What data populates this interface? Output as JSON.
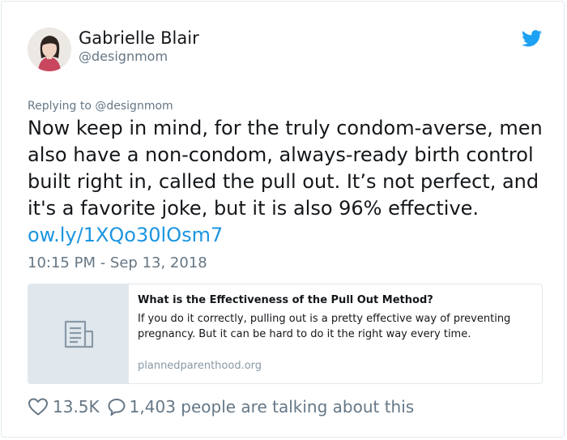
{
  "author": {
    "display_name": "Gabrielle Blair",
    "handle": "@designmom"
  },
  "tweet": {
    "reply_context": "Replying to @designmom",
    "text_lines": [
      "Now keep in mind, for the truly condom-averse, men",
      "also have a non-condom, always-ready birth control",
      "built right in, called the pull out. It’s not perfect, and",
      "it's a favorite joke, but it is also 96% effective."
    ],
    "link_text": "ow.ly/1XQo30lOsm7",
    "timestamp": "10:15 PM - Sep 13, 2018"
  },
  "link_card": {
    "title": "What is the Effectiveness of the Pull Out Method?",
    "description": "If you do it correctly, pulling out is a pretty effective way of preventing pregnancy. But it can be hard to do it the right way every time.",
    "domain": "plannedparenthood.org",
    "thumbnail_icon": "document-icon"
  },
  "engagement": {
    "likes": "13.5K",
    "replies_text": "1,403 people are talking about this"
  },
  "icons": {
    "brand": "twitter-bird-icon",
    "like": "heart-icon",
    "reply": "speech-bubble-icon"
  },
  "colors": {
    "link": "#1b95e0",
    "twitter_brand": "#1da1f2",
    "secondary_text": "#657786",
    "border": "#e1e8ed"
  }
}
